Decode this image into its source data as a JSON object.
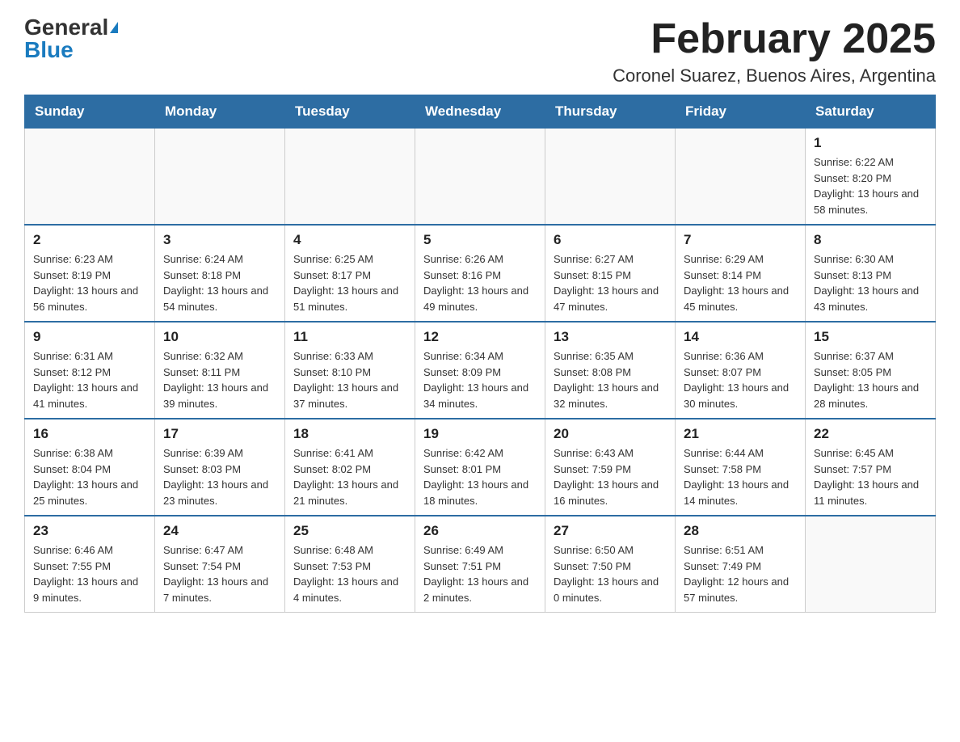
{
  "header": {
    "logo_general": "General",
    "logo_blue": "Blue",
    "month_title": "February 2025",
    "location": "Coronel Suarez, Buenos Aires, Argentina"
  },
  "days_of_week": [
    "Sunday",
    "Monday",
    "Tuesday",
    "Wednesday",
    "Thursday",
    "Friday",
    "Saturday"
  ],
  "weeks": [
    [
      {
        "day": "",
        "info": ""
      },
      {
        "day": "",
        "info": ""
      },
      {
        "day": "",
        "info": ""
      },
      {
        "day": "",
        "info": ""
      },
      {
        "day": "",
        "info": ""
      },
      {
        "day": "",
        "info": ""
      },
      {
        "day": "1",
        "info": "Sunrise: 6:22 AM\nSunset: 8:20 PM\nDaylight: 13 hours and 58 minutes."
      }
    ],
    [
      {
        "day": "2",
        "info": "Sunrise: 6:23 AM\nSunset: 8:19 PM\nDaylight: 13 hours and 56 minutes."
      },
      {
        "day": "3",
        "info": "Sunrise: 6:24 AM\nSunset: 8:18 PM\nDaylight: 13 hours and 54 minutes."
      },
      {
        "day": "4",
        "info": "Sunrise: 6:25 AM\nSunset: 8:17 PM\nDaylight: 13 hours and 51 minutes."
      },
      {
        "day": "5",
        "info": "Sunrise: 6:26 AM\nSunset: 8:16 PM\nDaylight: 13 hours and 49 minutes."
      },
      {
        "day": "6",
        "info": "Sunrise: 6:27 AM\nSunset: 8:15 PM\nDaylight: 13 hours and 47 minutes."
      },
      {
        "day": "7",
        "info": "Sunrise: 6:29 AM\nSunset: 8:14 PM\nDaylight: 13 hours and 45 minutes."
      },
      {
        "day": "8",
        "info": "Sunrise: 6:30 AM\nSunset: 8:13 PM\nDaylight: 13 hours and 43 minutes."
      }
    ],
    [
      {
        "day": "9",
        "info": "Sunrise: 6:31 AM\nSunset: 8:12 PM\nDaylight: 13 hours and 41 minutes."
      },
      {
        "day": "10",
        "info": "Sunrise: 6:32 AM\nSunset: 8:11 PM\nDaylight: 13 hours and 39 minutes."
      },
      {
        "day": "11",
        "info": "Sunrise: 6:33 AM\nSunset: 8:10 PM\nDaylight: 13 hours and 37 minutes."
      },
      {
        "day": "12",
        "info": "Sunrise: 6:34 AM\nSunset: 8:09 PM\nDaylight: 13 hours and 34 minutes."
      },
      {
        "day": "13",
        "info": "Sunrise: 6:35 AM\nSunset: 8:08 PM\nDaylight: 13 hours and 32 minutes."
      },
      {
        "day": "14",
        "info": "Sunrise: 6:36 AM\nSunset: 8:07 PM\nDaylight: 13 hours and 30 minutes."
      },
      {
        "day": "15",
        "info": "Sunrise: 6:37 AM\nSunset: 8:05 PM\nDaylight: 13 hours and 28 minutes."
      }
    ],
    [
      {
        "day": "16",
        "info": "Sunrise: 6:38 AM\nSunset: 8:04 PM\nDaylight: 13 hours and 25 minutes."
      },
      {
        "day": "17",
        "info": "Sunrise: 6:39 AM\nSunset: 8:03 PM\nDaylight: 13 hours and 23 minutes."
      },
      {
        "day": "18",
        "info": "Sunrise: 6:41 AM\nSunset: 8:02 PM\nDaylight: 13 hours and 21 minutes."
      },
      {
        "day": "19",
        "info": "Sunrise: 6:42 AM\nSunset: 8:01 PM\nDaylight: 13 hours and 18 minutes."
      },
      {
        "day": "20",
        "info": "Sunrise: 6:43 AM\nSunset: 7:59 PM\nDaylight: 13 hours and 16 minutes."
      },
      {
        "day": "21",
        "info": "Sunrise: 6:44 AM\nSunset: 7:58 PM\nDaylight: 13 hours and 14 minutes."
      },
      {
        "day": "22",
        "info": "Sunrise: 6:45 AM\nSunset: 7:57 PM\nDaylight: 13 hours and 11 minutes."
      }
    ],
    [
      {
        "day": "23",
        "info": "Sunrise: 6:46 AM\nSunset: 7:55 PM\nDaylight: 13 hours and 9 minutes."
      },
      {
        "day": "24",
        "info": "Sunrise: 6:47 AM\nSunset: 7:54 PM\nDaylight: 13 hours and 7 minutes."
      },
      {
        "day": "25",
        "info": "Sunrise: 6:48 AM\nSunset: 7:53 PM\nDaylight: 13 hours and 4 minutes."
      },
      {
        "day": "26",
        "info": "Sunrise: 6:49 AM\nSunset: 7:51 PM\nDaylight: 13 hours and 2 minutes."
      },
      {
        "day": "27",
        "info": "Sunrise: 6:50 AM\nSunset: 7:50 PM\nDaylight: 13 hours and 0 minutes."
      },
      {
        "day": "28",
        "info": "Sunrise: 6:51 AM\nSunset: 7:49 PM\nDaylight: 12 hours and 57 minutes."
      },
      {
        "day": "",
        "info": ""
      }
    ]
  ]
}
